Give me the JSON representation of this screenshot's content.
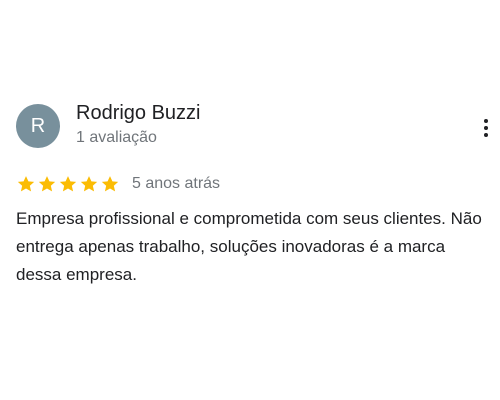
{
  "review": {
    "avatar_letter": "R",
    "avatar_color": "#78909c",
    "author_name": "Rodrigo Buzzi",
    "author_meta": "1 avaliação",
    "rating": 5,
    "rating_max": 5,
    "star_color": "#fbbc04",
    "date": "5 anos atrás",
    "text": "Empresa profissional e comprometida com seus clientes. Não entrega apenas trabalho, soluções inovadoras é a marca dessa empresa.",
    "more_icon": "more-vert-icon"
  }
}
